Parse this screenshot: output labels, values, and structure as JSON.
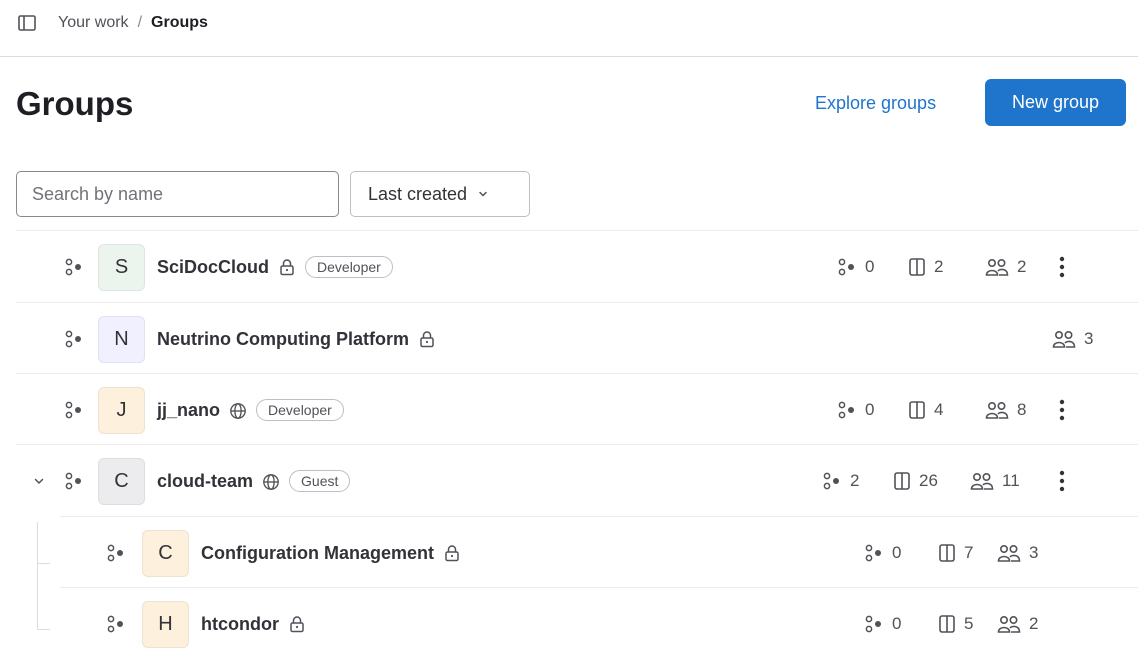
{
  "breadcrumb": {
    "parent": "Your work",
    "separator": "/",
    "current": "Groups"
  },
  "page": {
    "title": "Groups",
    "explore_label": "Explore groups",
    "new_group_label": "New group"
  },
  "filters": {
    "search_placeholder": "Search by name",
    "sort_label": "Last created"
  },
  "colors": {
    "accent": "#1f75cb"
  },
  "groups": [
    {
      "initial": "S",
      "name": "SciDocCloud",
      "visibility": "lock-icon",
      "role": "Developer",
      "subgroups": "0",
      "projects": "2",
      "members": "2",
      "avatar_color": "#ecf4ee"
    },
    {
      "initial": "N",
      "name": "Neutrino Computing Platform",
      "visibility": "lock-icon",
      "members": "3",
      "avatar_color": "#f1f0fe"
    },
    {
      "initial": "J",
      "name": "jj_nano",
      "visibility": "globe-icon",
      "role": "Developer",
      "subgroups": "0",
      "projects": "4",
      "members": "8",
      "avatar_color": "#fdf1dd"
    },
    {
      "initial": "C",
      "name": "cloud-team",
      "visibility": "globe-icon",
      "role": "Guest",
      "subgroups": "2",
      "projects": "26",
      "members": "11",
      "avatar_color": "#ececef"
    },
    {
      "initial": "C",
      "name": "Configuration Management",
      "visibility": "lock-icon",
      "subgroups": "0",
      "projects": "7",
      "members": "3",
      "avatar_color": "#fdf1dd"
    },
    {
      "initial": "H",
      "name": "htcondor",
      "visibility": "lock-icon",
      "subgroups": "0",
      "projects": "5",
      "members": "2",
      "avatar_color": "#fdf1dd"
    }
  ]
}
